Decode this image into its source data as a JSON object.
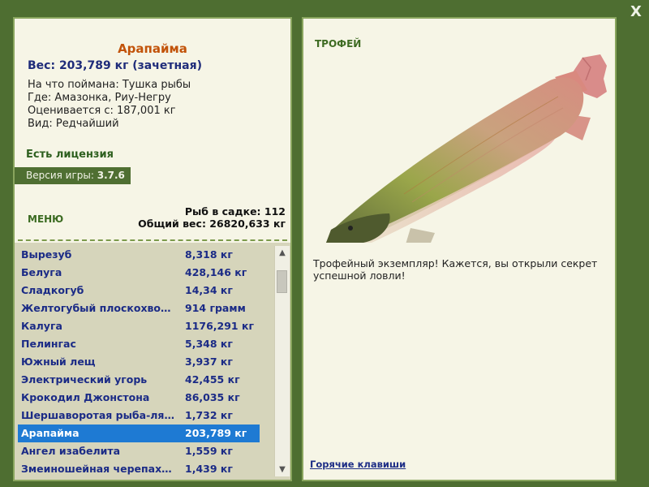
{
  "window": {
    "close_label": "X"
  },
  "fish": {
    "title": "Арапайма",
    "weight_line": "Вес: 203,789 кг (зачетная)",
    "bait_line": "На что поймана: Тушка рыбы",
    "location_line": "Где: Амазонка, Риу-Негру",
    "rated_line": "Оценивается с: 187,001 кг",
    "rarity_line": "Вид: Редчайший"
  },
  "license_label": "Есть лицензия",
  "version": {
    "label": "Версия игры:",
    "value": "3.7.6"
  },
  "menu_label": "МЕНЮ",
  "stats": {
    "fish_count": "Рыб в садке: 112",
    "total_weight": "Общий вес: 26820,633 кг"
  },
  "catch_list": [
    {
      "name": "Вырезуб",
      "weight": "8,318 кг"
    },
    {
      "name": "Белуга",
      "weight": "428,146 кг"
    },
    {
      "name": "Сладкогуб",
      "weight": "14,34 кг"
    },
    {
      "name": "Желтогубый плоскохво…",
      "weight": "914 грамм"
    },
    {
      "name": "Калуга",
      "weight": "1176,291 кг"
    },
    {
      "name": "Пелингас",
      "weight": "5,348 кг"
    },
    {
      "name": "Южный лещ",
      "weight": "3,937 кг"
    },
    {
      "name": "Электрический угорь",
      "weight": "42,455 кг"
    },
    {
      "name": "Крокодил Джонстона",
      "weight": "86,035 кг"
    },
    {
      "name": "Шершаворотая рыба-ля…",
      "weight": "1,732 кг"
    },
    {
      "name": "Арапайма",
      "weight": "203,789 кг",
      "selected": true
    },
    {
      "name": "Ангел изабелита",
      "weight": "1,559 кг"
    },
    {
      "name": "Змеиношейная черепах…",
      "weight": "1,439 кг"
    }
  ],
  "trophy": {
    "label": "ТРОФЕЙ",
    "text": "Трофейный экземпляр! Кажется, вы открыли секрет успешной ловли!",
    "image_icon": "arapaima-fish-image"
  },
  "hotkeys_label": "Горячие клавиши",
  "colors": {
    "background": "#4e6e31",
    "panel": "#f6f5e6",
    "title_accent": "#c2530a",
    "list_text": "#1b2b86",
    "selection": "#1e7ad3"
  }
}
